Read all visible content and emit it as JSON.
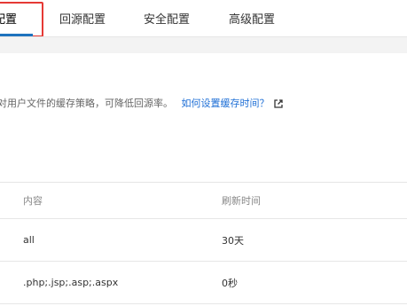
{
  "tabs": {
    "cache_label": "缓存配置",
    "origin_label": "回源配置",
    "security_label": "安全配置",
    "advanced_label": "高级配置"
  },
  "description": {
    "text": "针对用户文件的缓存策略，可降低回源率。",
    "link_label": "如何设置缓存时间？"
  },
  "table": {
    "headers": {
      "content": "内容",
      "refresh_time": "刷新时间"
    },
    "rows": [
      {
        "content": "all",
        "refresh_time": "30天"
      },
      {
        "content": ".php;.jsp;.asp;.aspx",
        "refresh_time": "0秒"
      }
    ]
  },
  "colors": {
    "accent": "#1e73be",
    "highlight_box": "#e53935",
    "link": "#1e6fd6"
  },
  "icons": {
    "external_link": "external-link-icon"
  }
}
